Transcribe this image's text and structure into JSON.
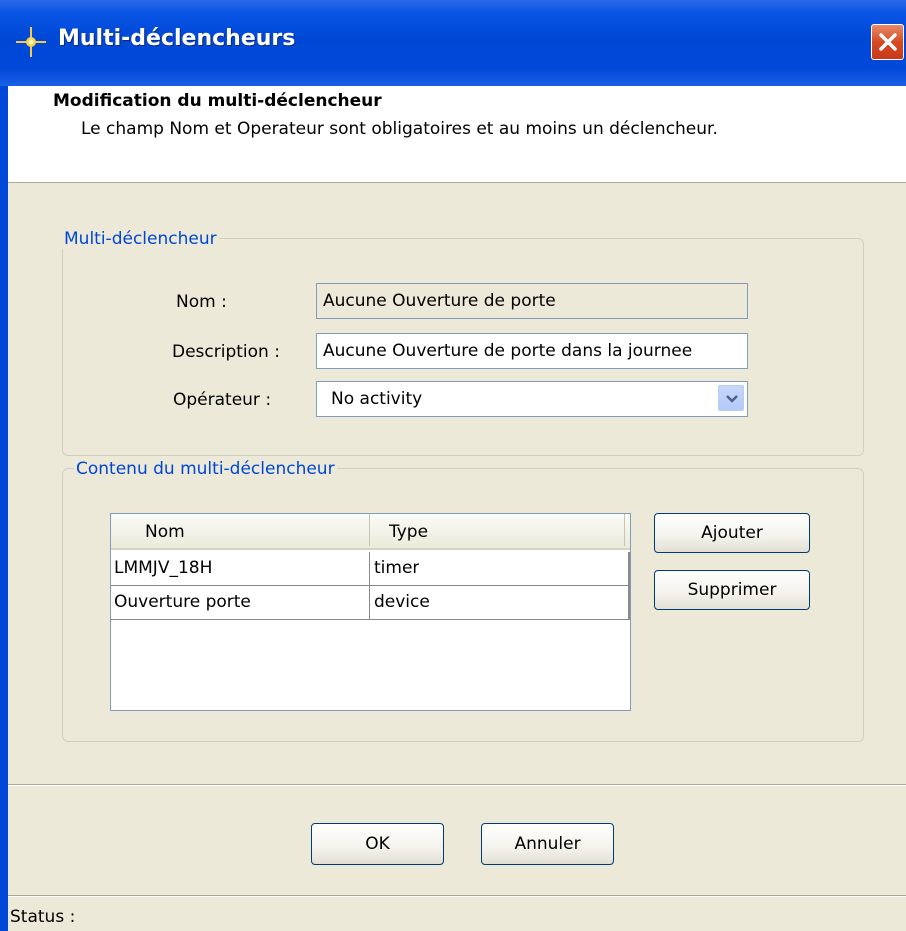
{
  "window": {
    "title": "Multi-déclencheurs",
    "icon": "sparkle-icon",
    "close_icon": "close-icon"
  },
  "header": {
    "title": "Modification du multi-déclencheur",
    "subtitle": "Le champ Nom et Operateur sont obligatoires et au moins un déclencheur."
  },
  "group_multi": {
    "legend": "Multi-déclencheur",
    "nom_label": "Nom :",
    "nom_value": "Aucune Ouverture de porte",
    "description_label": "Description :",
    "description_value": "Aucune Ouverture de porte dans la journee",
    "operateur_label": "Opérateur :",
    "operateur_value": "No activity"
  },
  "group_contenu": {
    "legend": "Contenu du multi-déclencheur",
    "columns": [
      "Nom",
      "Type"
    ],
    "rows": [
      {
        "nom": "LMMJV_18H",
        "type": "timer"
      },
      {
        "nom": "Ouverture porte",
        "type": "device"
      }
    ],
    "add_button": "Ajouter",
    "remove_button": "Supprimer"
  },
  "footer": {
    "ok": "OK",
    "cancel": "Annuler"
  },
  "status": {
    "label": "Status :"
  },
  "colors": {
    "titlebar": "#0049d8",
    "legend": "#0046d5",
    "background": "#ece9d8",
    "close": "#d64a22"
  }
}
